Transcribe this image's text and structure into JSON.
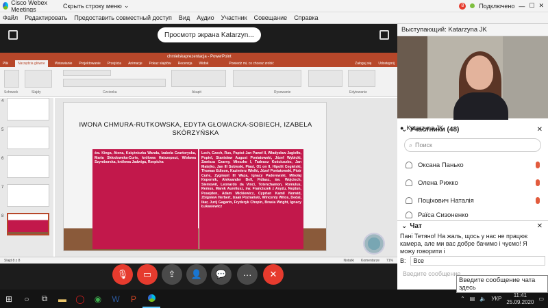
{
  "titlebar": {
    "app_name": "Cisco Webex Meetings",
    "hide_label": "Скрыть строку меню",
    "connection": "Подключено",
    "rec_badge": "8"
  },
  "menu": [
    "Файл",
    "Редактировать",
    "Предоставить совместный доступ",
    "Вид",
    "Аудио",
    "Участник",
    "Совещание",
    "Справка"
  ],
  "view_pill": "Просмотр экрана Katarzyn...",
  "ppt": {
    "filename": "chmielskaprezentacja - PowerPoint",
    "tabs": [
      "Plik",
      "Narzędzia główne",
      "Wstawianie",
      "Projektowanie",
      "Przejścia",
      "Animacje",
      "Pokaz slajdów",
      "Recenzja",
      "Widok"
    ],
    "active_tab": "Narzędzia główne",
    "tell_me": "Powiedz mi, co chcesz zrobić",
    "login": "Zaloguj się",
    "share": "Udostępnij",
    "groups": [
      "Schowek",
      "Slajdy",
      "Czcionka",
      "Akapit",
      "Rysowanie",
      "Edytowanie"
    ],
    "slide_count": "Slajd 8 z 8",
    "notes": "Notatki",
    "comments": "Komentarze",
    "zoom": "71%",
    "thumb_numbers": [
      "4",
      "5",
      "6",
      "7",
      "8"
    ]
  },
  "slide": {
    "title": "IWONA CHMURA-RUTKOWSKA, EDYTA GŁOWACKA-SOBIECH, IZABELA SKÓRZYŃSKA",
    "left_text": "św. Kinga, Atena, Księżniczka Wanda, Izabela Czartoryska, Maria Skłodowska-Curie, królowa Hatszepsut, Wisława Szymborska, królowa Jadwiga, Rzepicha",
    "right_text": "Lech, Czech, Rus, Papież Jan Paweł II, Władysław Jagiełło, Popiel, Stanisław August Poniatowski, Józef Wybicki, Zawisza Czarny, Mieszko I, Tadeusz Kościuszko, Jan Matejko, Jan III Sobieski, Piast, O1 on II, Hipolit Cegielski, Thomas Edison, Kazimierz Wielki, Józef Poniatowski, Piotr Curie, Zygmunt III Waza, Ignacy Paderewski, Mikołaj Kopernik, Aleksander Bell, Fidiasz, św. Wojciech, Siemowit, Leonardo da Vinci, Totenchamon, Romulus, Remus, Marek Aureliusz, św. Franciszek z Asyżu, Neptun, Posejdon, Adam Mickiewicz, Cyprian Kamil Norwid, Zbigniew Herbert, Izaak Poznański, Wincenty Witos, Dedal, Ikar, Jurij Gagarin, Fryderyk Chopin, Brasia Wright, Ignacy Łukasiewicz"
  },
  "right_panel": {
    "presenter": "Выступающий: Katarzyna JK",
    "video_name": "Katarzyna JK",
    "participants_title": "Участники (48)",
    "search_placeholder": "Поиск",
    "participants": [
      "Оксана Панько",
      "Олена Рижко",
      "Поціхович Наталія",
      "Раїса Сизоненко"
    ],
    "chat_title": "Чат",
    "chat_message": "Пані Тетяно! На жаль, щось у нас не працює камера, але ми вас добре бачимо і чуємо! Я можу говорити і",
    "chat_to_label": "В:",
    "chat_to_value": "Все",
    "chat_placeholder": "Введите сообщение",
    "tooltip": "Введите сообщение чата здесь"
  },
  "taskbar": {
    "language": "УКР",
    "time": "11:41",
    "date": "25.09.2020"
  },
  "colors": {
    "ppt_brand": "#b7472a",
    "slide_box": "#c2184b",
    "mute_red": "#e63b2e",
    "control_gray": "#4a4a4a"
  }
}
